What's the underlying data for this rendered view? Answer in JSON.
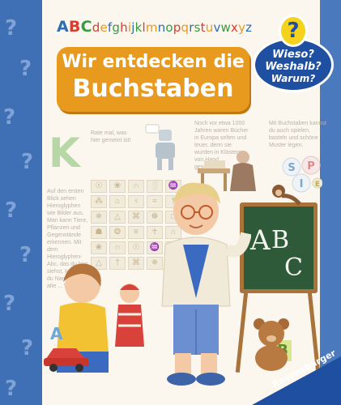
{
  "alphabet": [
    {
      "ch": "A",
      "color": "#2d6cb5"
    },
    {
      "ch": "B",
      "color": "#e0392b"
    },
    {
      "ch": "C",
      "color": "#3a9a3f"
    },
    {
      "ch": "d",
      "color": "#e0392b"
    },
    {
      "ch": "e",
      "color": "#e89a1e"
    },
    {
      "ch": "f",
      "color": "#2d6cb5"
    },
    {
      "ch": "g",
      "color": "#3a9a3f"
    },
    {
      "ch": "h",
      "color": "#e0392b"
    },
    {
      "ch": "i",
      "color": "#e89a1e"
    },
    {
      "ch": "j",
      "color": "#2d6cb5"
    },
    {
      "ch": "k",
      "color": "#3a9a3f"
    },
    {
      "ch": "l",
      "color": "#e0392b"
    },
    {
      "ch": "m",
      "color": "#e89a1e"
    },
    {
      "ch": "n",
      "color": "#2d6cb5"
    },
    {
      "ch": "o",
      "color": "#3a9a3f"
    },
    {
      "ch": "p",
      "color": "#e0392b"
    },
    {
      "ch": "q",
      "color": "#e89a1e"
    },
    {
      "ch": "r",
      "color": "#2d6cb5"
    },
    {
      "ch": "s",
      "color": "#3a9a3f"
    },
    {
      "ch": "t",
      "color": "#e0392b"
    },
    {
      "ch": "u",
      "color": "#e89a1e"
    },
    {
      "ch": "v",
      "color": "#2d6cb5"
    },
    {
      "ch": "w",
      "color": "#3a9a3f"
    },
    {
      "ch": "x",
      "color": "#e0392b"
    },
    {
      "ch": "y",
      "color": "#e89a1e"
    },
    {
      "ch": "z",
      "color": "#2d6cb5"
    }
  ],
  "title": {
    "line1": "Wir entdecken die",
    "line2": "Buchstaben"
  },
  "series_logo": {
    "mark": "?",
    "word1": "Wieso?",
    "word2": "Weshalb?",
    "word3": "Warum?"
  },
  "texts": {
    "riddle": "Rate mal, was hier gemeint ist!",
    "books": "Noch vor etwa 1000 Jahren waren Bücher in Europa selten und teuer, denn sie wurden in Klöstern von Hand geschrieben.",
    "play": "Mit Buchstaben kannst du auch spielen, basteln und schöne Muster legen.",
    "hieroglyphs": "Auf den ersten Blick sehen Hieroglyphen wie Bilder aus. Man kann Tiere, Pflanzen und Gegenstände erkennen. Mit dem Hieroglyphen-Abc, das du hier siehst, kannst du Namen ... alte ... Wo ..."
  },
  "big_letter": "K",
  "board_letters": [
    "A",
    "B",
    "C"
  ],
  "cube_letters": [
    "S",
    "P",
    "I",
    "E"
  ],
  "floor_letters": [
    "A",
    "B"
  ],
  "publisher": "Ravensburger",
  "colors": {
    "spine": "#3f6fb5",
    "banner": "#e89a1e",
    "logo": "#1f4fa0",
    "board": "#2e5a3a"
  }
}
